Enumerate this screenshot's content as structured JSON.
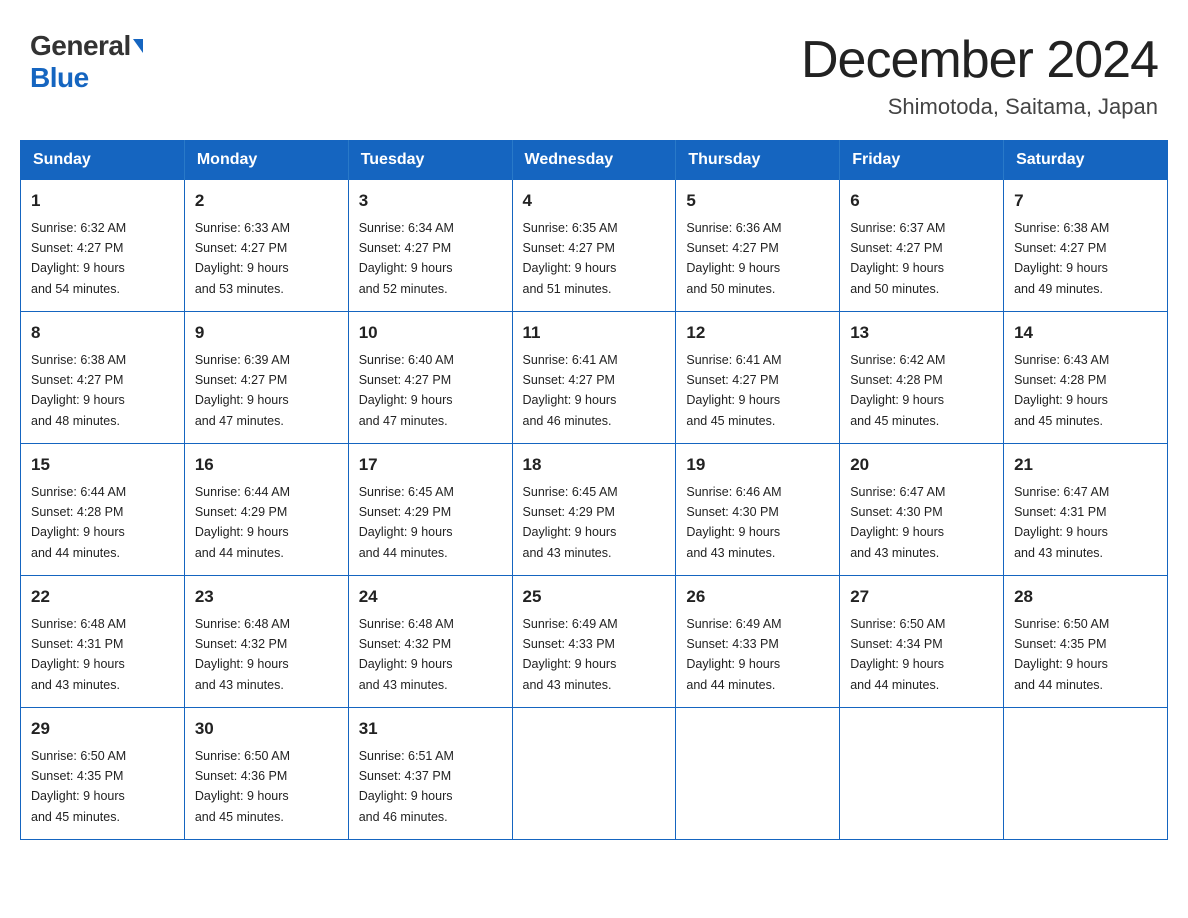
{
  "logo": {
    "general": "General",
    "blue": "Blue"
  },
  "title": {
    "month_year": "December 2024",
    "location": "Shimotoda, Saitama, Japan"
  },
  "weekdays": [
    "Sunday",
    "Monday",
    "Tuesday",
    "Wednesday",
    "Thursday",
    "Friday",
    "Saturday"
  ],
  "weeks": [
    [
      {
        "day": "1",
        "sunrise": "6:32 AM",
        "sunset": "4:27 PM",
        "daylight": "9 hours and 54 minutes."
      },
      {
        "day": "2",
        "sunrise": "6:33 AM",
        "sunset": "4:27 PM",
        "daylight": "9 hours and 53 minutes."
      },
      {
        "day": "3",
        "sunrise": "6:34 AM",
        "sunset": "4:27 PM",
        "daylight": "9 hours and 52 minutes."
      },
      {
        "day": "4",
        "sunrise": "6:35 AM",
        "sunset": "4:27 PM",
        "daylight": "9 hours and 51 minutes."
      },
      {
        "day": "5",
        "sunrise": "6:36 AM",
        "sunset": "4:27 PM",
        "daylight": "9 hours and 50 minutes."
      },
      {
        "day": "6",
        "sunrise": "6:37 AM",
        "sunset": "4:27 PM",
        "daylight": "9 hours and 50 minutes."
      },
      {
        "day": "7",
        "sunrise": "6:38 AM",
        "sunset": "4:27 PM",
        "daylight": "9 hours and 49 minutes."
      }
    ],
    [
      {
        "day": "8",
        "sunrise": "6:38 AM",
        "sunset": "4:27 PM",
        "daylight": "9 hours and 48 minutes."
      },
      {
        "day": "9",
        "sunrise": "6:39 AM",
        "sunset": "4:27 PM",
        "daylight": "9 hours and 47 minutes."
      },
      {
        "day": "10",
        "sunrise": "6:40 AM",
        "sunset": "4:27 PM",
        "daylight": "9 hours and 47 minutes."
      },
      {
        "day": "11",
        "sunrise": "6:41 AM",
        "sunset": "4:27 PM",
        "daylight": "9 hours and 46 minutes."
      },
      {
        "day": "12",
        "sunrise": "6:41 AM",
        "sunset": "4:27 PM",
        "daylight": "9 hours and 45 minutes."
      },
      {
        "day": "13",
        "sunrise": "6:42 AM",
        "sunset": "4:28 PM",
        "daylight": "9 hours and 45 minutes."
      },
      {
        "day": "14",
        "sunrise": "6:43 AM",
        "sunset": "4:28 PM",
        "daylight": "9 hours and 45 minutes."
      }
    ],
    [
      {
        "day": "15",
        "sunrise": "6:44 AM",
        "sunset": "4:28 PM",
        "daylight": "9 hours and 44 minutes."
      },
      {
        "day": "16",
        "sunrise": "6:44 AM",
        "sunset": "4:29 PM",
        "daylight": "9 hours and 44 minutes."
      },
      {
        "day": "17",
        "sunrise": "6:45 AM",
        "sunset": "4:29 PM",
        "daylight": "9 hours and 44 minutes."
      },
      {
        "day": "18",
        "sunrise": "6:45 AM",
        "sunset": "4:29 PM",
        "daylight": "9 hours and 43 minutes."
      },
      {
        "day": "19",
        "sunrise": "6:46 AM",
        "sunset": "4:30 PM",
        "daylight": "9 hours and 43 minutes."
      },
      {
        "day": "20",
        "sunrise": "6:47 AM",
        "sunset": "4:30 PM",
        "daylight": "9 hours and 43 minutes."
      },
      {
        "day": "21",
        "sunrise": "6:47 AM",
        "sunset": "4:31 PM",
        "daylight": "9 hours and 43 minutes."
      }
    ],
    [
      {
        "day": "22",
        "sunrise": "6:48 AM",
        "sunset": "4:31 PM",
        "daylight": "9 hours and 43 minutes."
      },
      {
        "day": "23",
        "sunrise": "6:48 AM",
        "sunset": "4:32 PM",
        "daylight": "9 hours and 43 minutes."
      },
      {
        "day": "24",
        "sunrise": "6:48 AM",
        "sunset": "4:32 PM",
        "daylight": "9 hours and 43 minutes."
      },
      {
        "day": "25",
        "sunrise": "6:49 AM",
        "sunset": "4:33 PM",
        "daylight": "9 hours and 43 minutes."
      },
      {
        "day": "26",
        "sunrise": "6:49 AM",
        "sunset": "4:33 PM",
        "daylight": "9 hours and 44 minutes."
      },
      {
        "day": "27",
        "sunrise": "6:50 AM",
        "sunset": "4:34 PM",
        "daylight": "9 hours and 44 minutes."
      },
      {
        "day": "28",
        "sunrise": "6:50 AM",
        "sunset": "4:35 PM",
        "daylight": "9 hours and 44 minutes."
      }
    ],
    [
      {
        "day": "29",
        "sunrise": "6:50 AM",
        "sunset": "4:35 PM",
        "daylight": "9 hours and 45 minutes."
      },
      {
        "day": "30",
        "sunrise": "6:50 AM",
        "sunset": "4:36 PM",
        "daylight": "9 hours and 45 minutes."
      },
      {
        "day": "31",
        "sunrise": "6:51 AM",
        "sunset": "4:37 PM",
        "daylight": "9 hours and 46 minutes."
      },
      null,
      null,
      null,
      null
    ]
  ],
  "labels": {
    "sunrise": "Sunrise:",
    "sunset": "Sunset:",
    "daylight": "Daylight:"
  }
}
